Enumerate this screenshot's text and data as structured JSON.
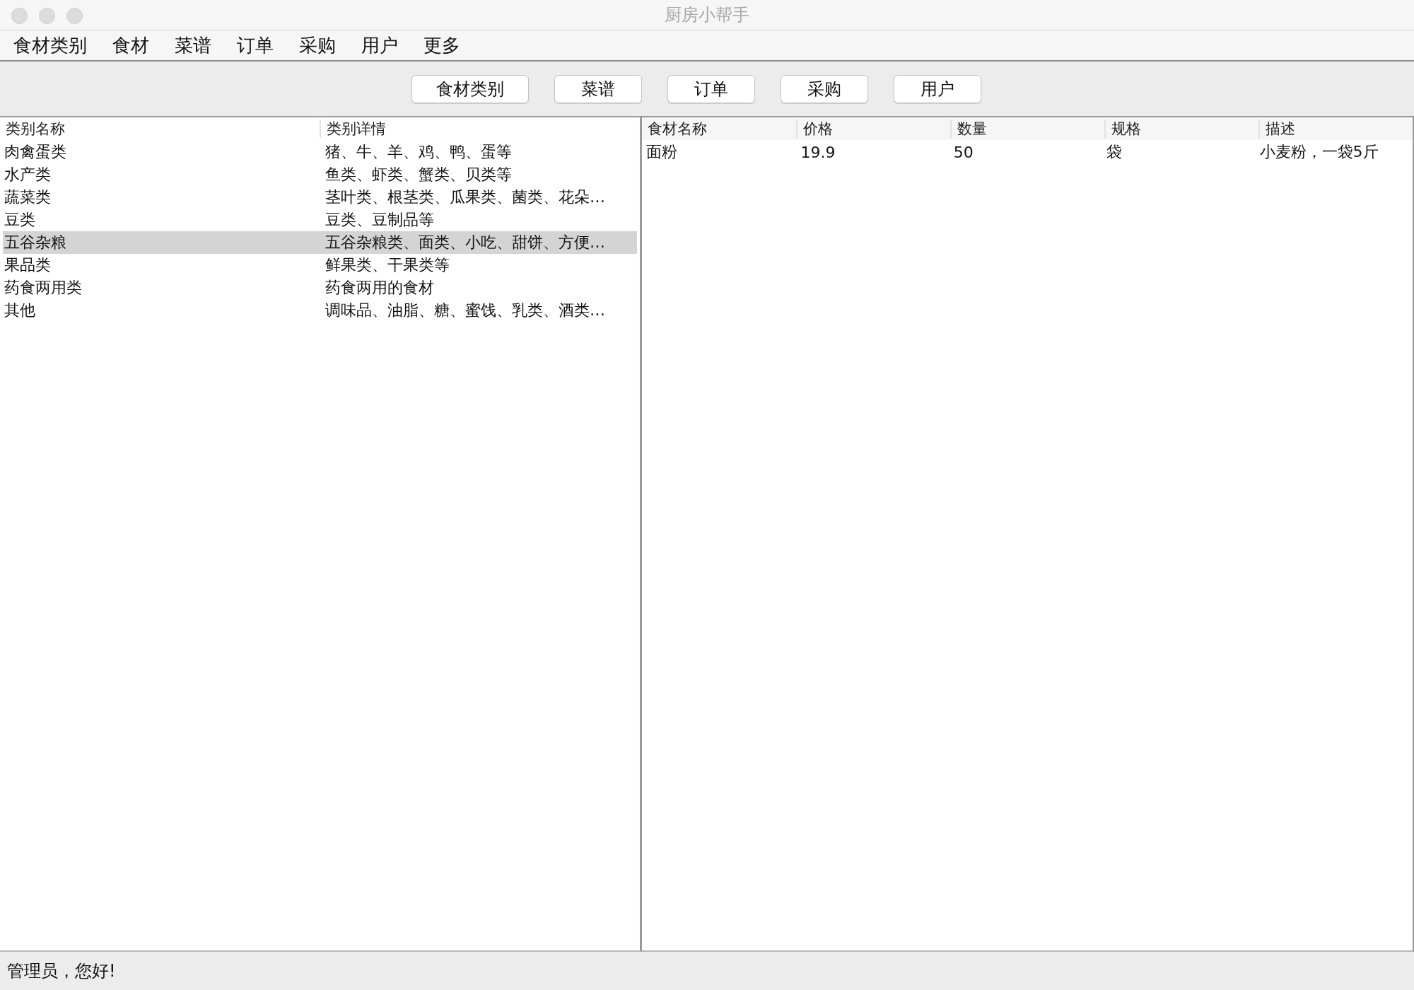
{
  "window": {
    "title": "厨房小帮手"
  },
  "menu": [
    "食材类别",
    "食材",
    "菜谱",
    "订单",
    "采购",
    "用户",
    "更多"
  ],
  "toolbar": [
    "食材类别",
    "菜谱",
    "订单",
    "采购",
    "用户"
  ],
  "category_table": {
    "columns": [
      "类别名称",
      "类别详情"
    ],
    "rows": [
      {
        "cells": [
          "肉禽蛋类",
          "猪、牛、羊、鸡、鸭、蛋等"
        ],
        "selected": false
      },
      {
        "cells": [
          "水产类",
          "鱼类、虾类、蟹类、贝类等"
        ],
        "selected": false
      },
      {
        "cells": [
          "蔬菜类",
          "茎叶类、根茎类、瓜果类、菌类、花朵…"
        ],
        "selected": false
      },
      {
        "cells": [
          "豆类",
          "豆类、豆制品等"
        ],
        "selected": false
      },
      {
        "cells": [
          "五谷杂粮",
          "五谷杂粮类、面类、小吃、甜饼、方便…"
        ],
        "selected": true
      },
      {
        "cells": [
          "果品类",
          "鲜果类、干果类等"
        ],
        "selected": false
      },
      {
        "cells": [
          "药食两用类",
          "药食两用的食材"
        ],
        "selected": false
      },
      {
        "cells": [
          "其他",
          "调味品、油脂、糖、蜜饯、乳类、酒类…"
        ],
        "selected": false
      }
    ]
  },
  "ingredient_table": {
    "columns": [
      "食材名称",
      "价格",
      "数量",
      "规格",
      "描述"
    ],
    "rows": [
      {
        "cells": [
          "面粉",
          "19.9",
          "50",
          "袋",
          "小麦粉，一袋5斤"
        ],
        "selected": false
      }
    ]
  },
  "status_bar": "管理员，您好!"
}
